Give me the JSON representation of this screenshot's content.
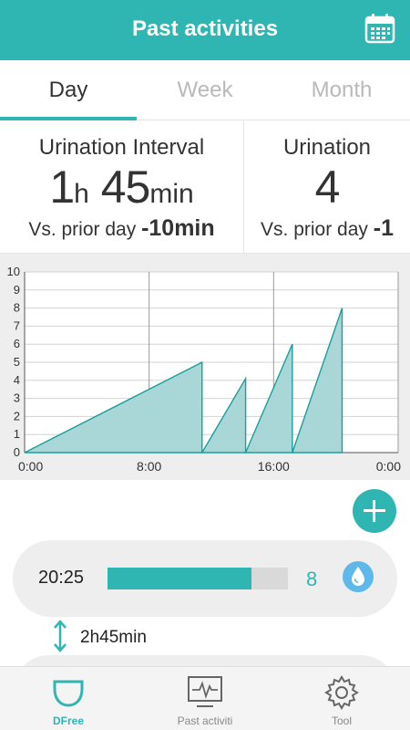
{
  "header": {
    "title": "Past activities",
    "calendar_icon": "calendar-icon"
  },
  "tabs": [
    {
      "label": "Day",
      "active": true
    },
    {
      "label": "Week",
      "active": false
    },
    {
      "label": "Month",
      "active": false
    }
  ],
  "summary": {
    "interval": {
      "label": "Urination Interval",
      "hours": "1",
      "hours_unit": "h",
      "minutes": "45",
      "minutes_unit": "min",
      "vs_label": "Vs. prior day",
      "delta": "-10min"
    },
    "count": {
      "label": "Urination",
      "value": "4",
      "vs_label": "Vs. prior day",
      "delta": "-1"
    }
  },
  "chart_data": {
    "type": "area",
    "x_ticks": [
      "0:00",
      "8:00",
      "16:00",
      "0:00"
    ],
    "y_ticks": [
      "0",
      "1",
      "2",
      "3",
      "4",
      "5",
      "6",
      "7",
      "8",
      "9",
      "10"
    ],
    "ylim": [
      0,
      10
    ],
    "xlim_hours": [
      0,
      24
    ],
    "grid": true,
    "series": [
      {
        "points": [
          [
            0.0,
            0
          ],
          [
            11.4,
            5
          ],
          [
            11.4,
            0
          ]
        ]
      },
      {
        "points": [
          [
            11.4,
            0
          ],
          [
            14.2,
            4.1
          ],
          [
            14.2,
            0
          ]
        ]
      },
      {
        "points": [
          [
            14.2,
            0
          ],
          [
            17.2,
            6
          ],
          [
            17.2,
            0
          ]
        ]
      },
      {
        "points": [
          [
            17.2,
            0
          ],
          [
            20.4,
            8
          ],
          [
            20.4,
            0
          ]
        ]
      }
    ],
    "fill_color": "#a9d6d6",
    "stroke_color": "#1a9f9d"
  },
  "add_button": {
    "icon": "plus-icon"
  },
  "records": [
    {
      "time": "20:25",
      "level": 0.8,
      "count": "8",
      "icon": "water-drop-icon"
    }
  ],
  "interval_row": {
    "text": "2h45min",
    "icon": "up-down-arrow-icon"
  },
  "bottom_nav": [
    {
      "label": "DFree",
      "icon": "dfree-device-icon",
      "active": true
    },
    {
      "label": "Past activiti",
      "icon": "chart-monitor-icon",
      "active": false
    },
    {
      "label": "Tool",
      "icon": "gear-icon",
      "active": false
    }
  ],
  "colors": {
    "accent": "#2fb5b2",
    "chart_bg": "#eeeeee"
  }
}
